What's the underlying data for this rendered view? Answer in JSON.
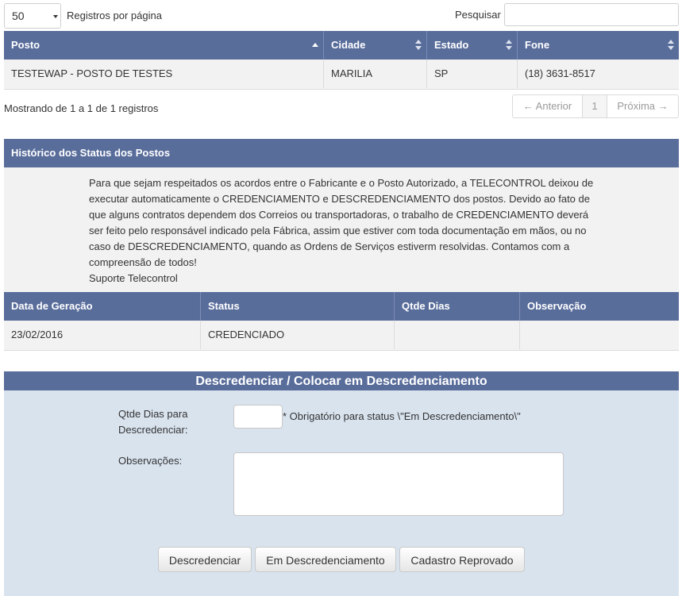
{
  "length_menu": {
    "value": "50",
    "label": "Registros por página"
  },
  "search": {
    "label": "Pesquisar",
    "value": ""
  },
  "postos_table": {
    "headers": [
      "Posto",
      "Cidade",
      "Estado",
      "Fone"
    ],
    "rows": [
      [
        "TESTEWAP - POSTO DE TESTES",
        "MARILIA",
        "SP",
        "(18) 3631-8517"
      ]
    ]
  },
  "info": "Mostrando de 1 a 1 de 1 registros",
  "pagination": {
    "previous": "← Anterior",
    "current": "1",
    "next": "Próxima →"
  },
  "history": {
    "title": "Histórico dos Status dos Postos",
    "notice_lines": [
      "Para que sejam respeitados os acordos entre o Fabricante e o Posto Autorizado, a TELECONTROL deixou de",
      "executar automaticamente o CREDENCIAMENTO e DESCREDENCIAMENTO dos postos. Devido ao fato de",
      "que alguns contratos dependem dos Correios ou transportadoras, o trabalho de CREDENCIAMENTO deverá",
      "ser feito pelo responsável indicado pela Fábrica, assim que estiver com toda documentação em mãos, ou no",
      "caso de DESCREDENCIAMENTO, quando as Ordens de Serviços estiverm resolvidas. Contamos com a",
      "compreensão de todos!",
      "Suporte Telecontrol"
    ],
    "headers": [
      "Data de Geração",
      "Status",
      "Qtde Dias",
      "Observação"
    ],
    "rows": [
      [
        "23/02/2016",
        "CREDENCIADO",
        "",
        ""
      ]
    ]
  },
  "form": {
    "title": "Descredenciar / Colocar em Descredenciamento",
    "qtde_label_1": "Qtde Dias para",
    "qtde_label_2": "Descredenciar:",
    "qtde_value": "",
    "qtde_hint": "* Obrigatório para status \\\"Em Descredenciamento\\\"",
    "obs_label": "Observações:",
    "obs_value": "",
    "buttons": {
      "descredenciar": "Descredenciar",
      "em_descredenciamento": "Em Descredenciamento",
      "cadastro_reprovado": "Cadastro Reprovado"
    }
  }
}
